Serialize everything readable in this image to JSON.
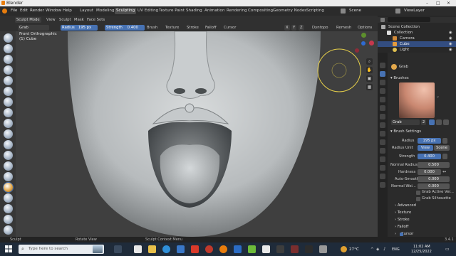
{
  "window": {
    "title": "Blender"
  },
  "menu": {
    "items": [
      "File",
      "Edit",
      "Render",
      "Window",
      "Help"
    ],
    "workspaces": [
      "Layout",
      "Modeling",
      "Sculpting",
      "UV Editing",
      "Texture Paint",
      "Shading",
      "Animation",
      "Rendering",
      "Compositing",
      "Geometry Nodes",
      "Scripting"
    ],
    "active_workspace": "Sculpting",
    "scene": "Scene",
    "view_layer": "ViewLayer"
  },
  "header": {
    "mode": "Sculpt Mode",
    "menus": [
      "View",
      "Sculpt",
      "Mask",
      "Face Sets"
    ],
    "brush_name": "Grab",
    "radius_label": "Radius",
    "radius_value": "195 px",
    "strength_label": "Strength",
    "strength_value": "0.400",
    "dropdowns": [
      "Brush",
      "Texture",
      "Stroke",
      "Falloff",
      "Cursor"
    ],
    "xyz": [
      "X",
      "Y",
      "Z"
    ],
    "dyntopo": "Dyntopo",
    "remesh": "Remesh",
    "options": "Options"
  },
  "viewport": {
    "view_name": "Front Orthographic",
    "object": "(1) Cube"
  },
  "outliner": {
    "root": "Scene Collection",
    "items": [
      "Collection",
      "Camera",
      "Cube",
      "Light"
    ]
  },
  "properties": {
    "brush_header": "Grab",
    "brushes_section": "Brushes",
    "brush_field": "Grab",
    "brush_users": "2",
    "brush_settings": "Brush Settings",
    "radius_label": "Radius",
    "radius_value": "195 px",
    "radius_unit_label": "Radius Unit",
    "unit_view": "View",
    "unit_scene": "Scene",
    "strength_label": "Strength",
    "strength_value": "0.400",
    "normal_radius_label": "Normal Radius",
    "normal_radius_value": "0.500",
    "hardness_label": "Hardness",
    "hardness_value": "0.000",
    "autosmooth_label": "Auto-Smooth",
    "autosmooth_value": "0.000",
    "normal_weight_label": "Normal Wei...",
    "normal_weight_value": "0.000",
    "grab_active_vertex": "Grab Active Ver...",
    "grab_silhouette": "Grab Silhouette",
    "subsections": [
      "Advanced",
      "Texture",
      "Stroke",
      "Falloff",
      "Cursor"
    ]
  },
  "statusbar": {
    "left": "Sculpt",
    "middle": "Rotate View",
    "context": "Sculpt Context Menu",
    "version": "3.4.1"
  },
  "taskbar": {
    "search_placeholder": "Type here to search",
    "temperature": "27°C",
    "language": "ENG",
    "time": "11:02 AM",
    "date": "12/25/2022"
  },
  "colors": {
    "accent": "#4772b3",
    "active_tool": "#e3a84c",
    "outliner_selected": "#334d80",
    "viewport_bg": "#3a3a3a"
  }
}
